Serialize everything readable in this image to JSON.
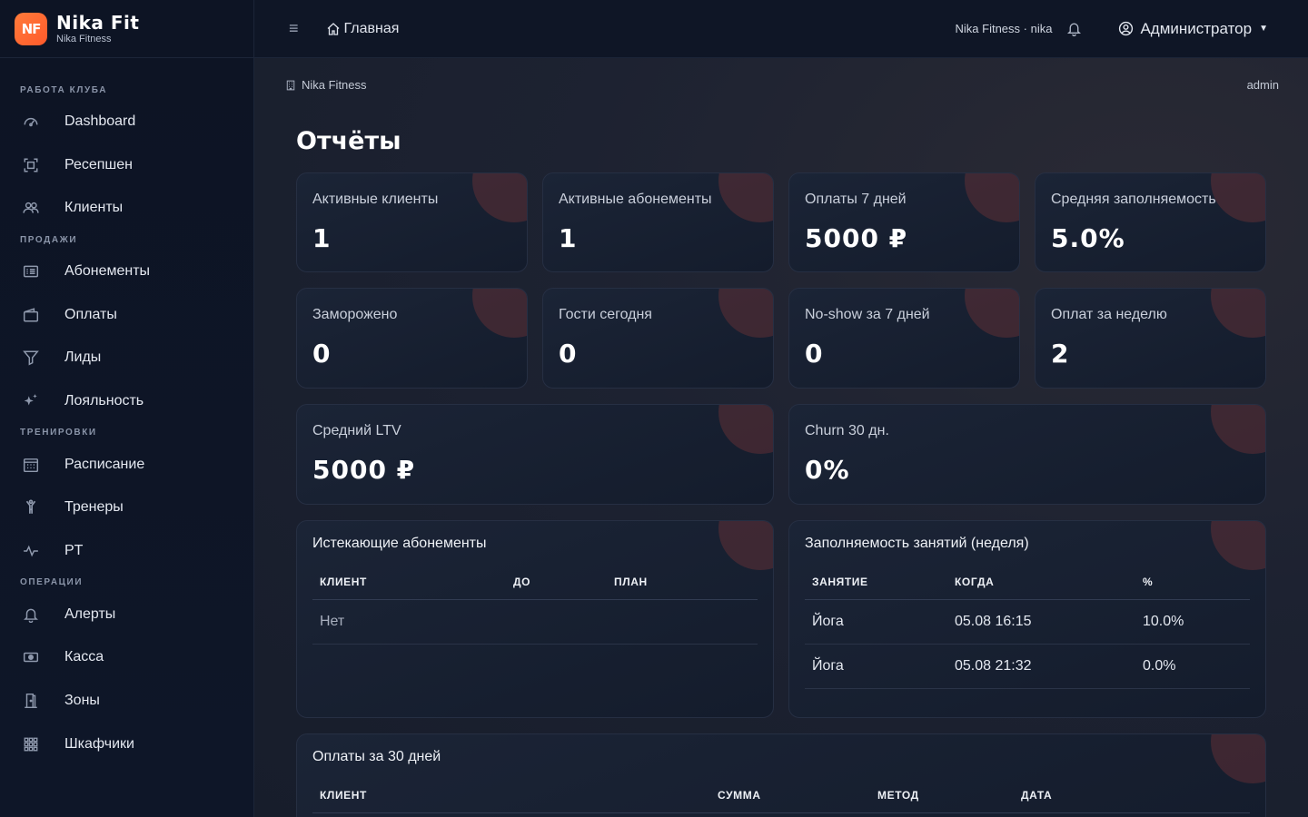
{
  "brand": {
    "logo": "NF",
    "title": "Nika Fit",
    "subtitle": "Nika Fitness"
  },
  "sidebar": {
    "sections": [
      {
        "heading": "РАБОТА КЛУБА",
        "items": [
          {
            "label": "Dashboard",
            "icon": "speedometer-icon"
          },
          {
            "label": "Ресепшен",
            "icon": "scan-icon"
          },
          {
            "label": "Клиенты",
            "icon": "people-icon"
          }
        ]
      },
      {
        "heading": "ПРОДАЖИ",
        "items": [
          {
            "label": "Абонементы",
            "icon": "card-list-icon"
          },
          {
            "label": "Оплаты",
            "icon": "wallet-icon"
          },
          {
            "label": "Лиды",
            "icon": "funnel-icon"
          },
          {
            "label": "Лояльность",
            "icon": "stars-icon"
          }
        ]
      },
      {
        "heading": "ТРЕНИРОВКИ",
        "items": [
          {
            "label": "Расписание",
            "icon": "calendar-icon"
          },
          {
            "label": "Тренеры",
            "icon": "person-arms-up-icon"
          },
          {
            "label": "PT",
            "icon": "activity-icon"
          }
        ]
      },
      {
        "heading": "ОПЕРАЦИИ",
        "items": [
          {
            "label": "Алерты",
            "icon": "bell-icon"
          },
          {
            "label": "Касса",
            "icon": "cash-icon"
          },
          {
            "label": "Зоны",
            "icon": "door-icon"
          },
          {
            "label": "Шкафчики",
            "icon": "grid-icon"
          }
        ]
      }
    ]
  },
  "topbar": {
    "home_label": "Главная",
    "org_label": "Nika Fitness · nika",
    "user_label": "Администратор"
  },
  "breadcrumb": {
    "left": "Nika Fitness",
    "right": "admin"
  },
  "page_title": "Отчёты",
  "stats": [
    {
      "label": "Активные клиенты",
      "value": "1"
    },
    {
      "label": "Активные абонементы",
      "value": "1"
    },
    {
      "label": "Оплаты 7 дней",
      "value": "5000 ₽"
    },
    {
      "label": "Средняя заполняемость",
      "value": "5.0%"
    },
    {
      "label": "Заморожено",
      "value": "0"
    },
    {
      "label": "Гости сегодня",
      "value": "0"
    },
    {
      "label": "No-show за 7 дней",
      "value": "0"
    },
    {
      "label": "Оплат за неделю",
      "value": "2"
    },
    {
      "label": "Средний LTV",
      "value": "5000 ₽"
    },
    {
      "label": "Churn 30 дн.",
      "value": "0%"
    }
  ],
  "expiring": {
    "title": "Истекающие абонементы",
    "columns": [
      "КЛИЕНТ",
      "ДО",
      "ПЛАН"
    ],
    "empty": "Нет"
  },
  "occupancy": {
    "title": "Заполняемость занятий (неделя)",
    "columns": [
      "ЗАНЯТИЕ",
      "КОГДА",
      "%"
    ],
    "rows": [
      [
        "Йога",
        "05.08 16:15",
        "10.0%"
      ],
      [
        "Йога",
        "05.08 21:32",
        "0.0%"
      ]
    ]
  },
  "payments": {
    "title": "Оплаты за 30 дней",
    "columns": [
      "КЛИЕНТ",
      "СУММА",
      "МЕТОД",
      "ДАТА"
    ]
  }
}
